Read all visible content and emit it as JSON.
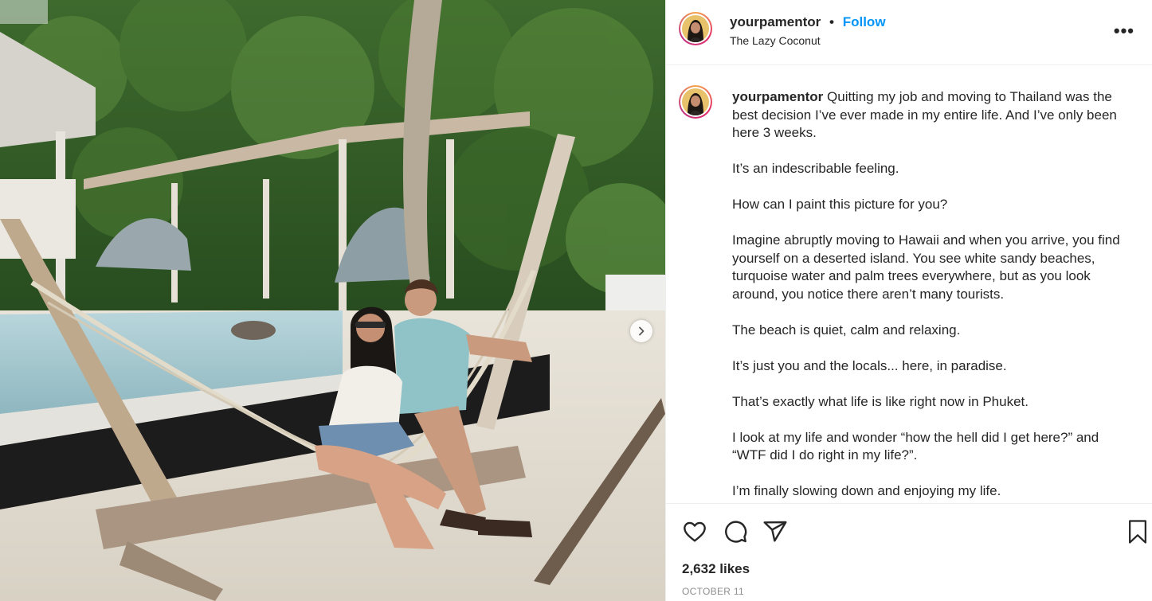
{
  "header": {
    "username": "yourpamentor",
    "separator": "•",
    "follow_label": "Follow",
    "location": "The Lazy Coconut",
    "more_label": "•••"
  },
  "caption": {
    "username": "yourpamentor",
    "paragraphs": [
      "Quitting my job and moving to Thailand was the best decision I’ve ever made in my entire life. And I’ve only been here 3 weeks.",
      "It’s an indescribable feeling.",
      "How can I paint this picture for you?",
      "Imagine abruptly moving to Hawaii and when you arrive, you find yourself on a deserted island. You see white sandy beaches, turquoise water and palm trees everywhere, but as you look around, you notice there aren’t many tourists.",
      "The beach is quiet, calm and relaxing.",
      "It’s just you and the locals... here, in paradise.",
      "That’s exactly what life is like right now in Phuket.",
      "I look at my life and wonder “how the hell did I get here?” and “WTF did I do right in my life?”.",
      "I’m finally slowing down and enjoying my life."
    ]
  },
  "actions": {
    "icons": [
      "heart-icon",
      "comment-icon",
      "share-icon",
      "bookmark-icon"
    ],
    "likes": "2,632 likes",
    "date": "OCTOBER 11"
  },
  "photo": {
    "icons": [
      "chevron-right-icon"
    ]
  },
  "colors": {
    "follow": "#0095f6",
    "text": "#262626",
    "muted": "#8e8e8e",
    "border": "#efefef"
  }
}
